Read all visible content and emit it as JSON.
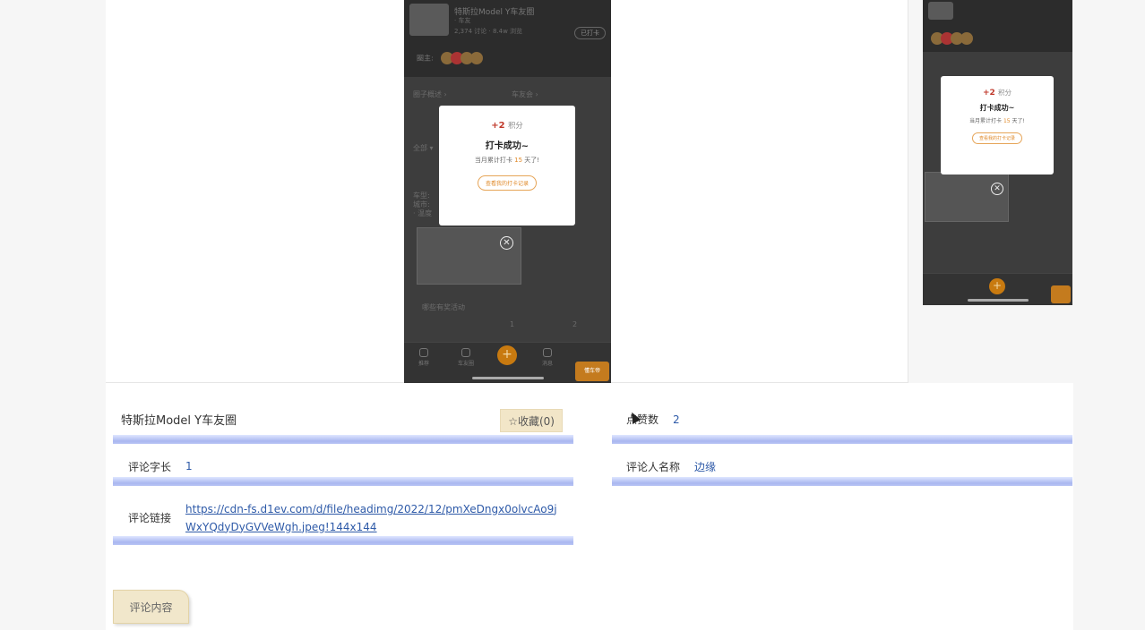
{
  "phone_main": {
    "group_title": "特斯拉Model Y车友圈",
    "group_sub": "· 车友",
    "group_stats": "2,374 讨论 · 8.4w 浏览",
    "checkin_pill": "已打卡",
    "members_label": "圈主:",
    "tab_intro": "圈子概述 ›",
    "tab_club": "车友会 ›",
    "filter": "全部 ▾",
    "post_lines": [
      "车型:",
      "城市:",
      "· 温度"
    ],
    "tag": "哪些有奖活动",
    "like_count": "1",
    "comment_count": "2",
    "nav": [
      "推荐",
      "车友圈",
      "消息",
      "我的"
    ],
    "badge": "懂车帝"
  },
  "modal": {
    "points": "+2",
    "points_unit": "积分",
    "title": "打卡成功~",
    "sub_prefix": "当月累计打卡",
    "sub_days": "15",
    "sub_suffix": "天了!",
    "record_button": "查看我的打卡记录"
  },
  "detail": {
    "title": "特斯拉Model Y车友圈",
    "fav_label": "☆收藏(0)",
    "likes_label": "点赞数",
    "likes_value": "2",
    "length_label": "评论字长",
    "length_value": "1",
    "commenter_label": "评论人名称",
    "commenter_value": "边缘",
    "link_label": "评论链接",
    "link_value": "https://cdn-fs.d1ev.com/d/file/headimg/2022/12/pmXeDngx0olvcAo9jWxYQdyDyGVVeWgh.jpeg!144x144",
    "content_tab": "评论内容"
  }
}
